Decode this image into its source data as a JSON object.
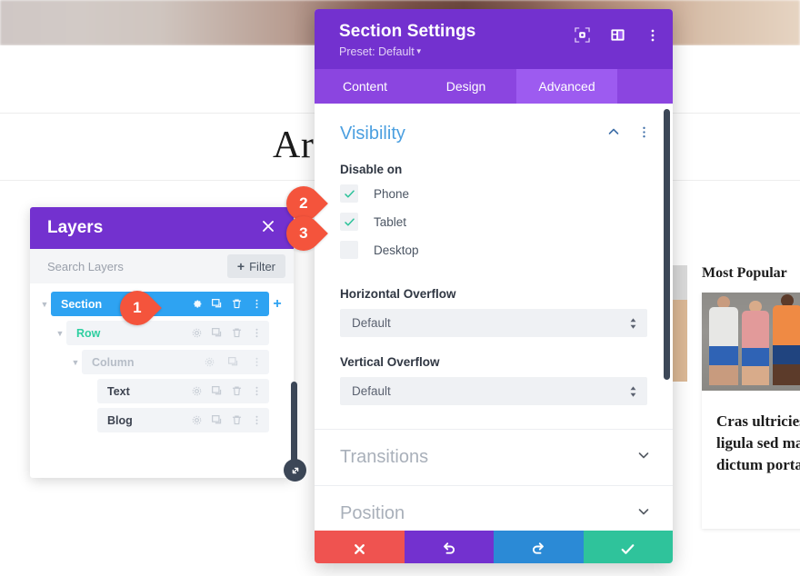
{
  "background": {
    "heading": "Ar",
    "most_popular_label": "Most Popular",
    "card_text": "Cras ultricies ligula sed magna dictum porta"
  },
  "layers_panel": {
    "title": "Layers",
    "close_icon": "close-icon",
    "search_placeholder": "Search Layers",
    "filter_label": "Filter",
    "filter_plus": "+",
    "add_plus": "+",
    "rows": [
      {
        "label": "Section",
        "icons": [
          "gear-icon",
          "duplicate-icon",
          "trash-icon",
          "more-icon"
        ]
      },
      {
        "label": "Row",
        "icons": [
          "gear-icon",
          "duplicate-icon",
          "trash-icon",
          "more-icon"
        ]
      },
      {
        "label": "Column",
        "icons": [
          "gear-icon",
          "duplicate-icon",
          "more-icon"
        ]
      },
      {
        "label": "Text",
        "icons": [
          "gear-icon",
          "duplicate-icon",
          "trash-icon",
          "more-icon"
        ]
      },
      {
        "label": "Blog",
        "icons": [
          "gear-icon",
          "duplicate-icon",
          "trash-icon",
          "more-icon"
        ]
      }
    ]
  },
  "settings_modal": {
    "title": "Section Settings",
    "preset_label": "Preset: Default",
    "header_icons": [
      "focus-icon",
      "layout-icon",
      "more-vertical-icon"
    ],
    "tabs": [
      {
        "label": "Content",
        "active": false
      },
      {
        "label": "Design",
        "active": false
      },
      {
        "label": "Advanced",
        "active": true
      }
    ],
    "visibility": {
      "section_title": "Visibility",
      "collapse_icon": "chevron-up-icon",
      "more_icon": "more-vertical-icon",
      "disable_on_label": "Disable on",
      "options": [
        {
          "label": "Phone",
          "checked": true
        },
        {
          "label": "Tablet",
          "checked": true
        },
        {
          "label": "Desktop",
          "checked": false
        }
      ],
      "horizontal_overflow_label": "Horizontal Overflow",
      "horizontal_overflow_value": "Default",
      "vertical_overflow_label": "Vertical Overflow",
      "vertical_overflow_value": "Default"
    },
    "collapsed_sections": [
      {
        "title": "Transitions",
        "icon": "chevron-down-icon"
      },
      {
        "title": "Position",
        "icon": "chevron-down-icon"
      }
    ],
    "footer_buttons": [
      {
        "name": "cancel-button",
        "icon": "close-icon",
        "color": "#ef5350"
      },
      {
        "name": "undo-button",
        "icon": "undo-icon",
        "color": "#7331cf"
      },
      {
        "name": "redo-button",
        "icon": "redo-icon",
        "color": "#2b8ad6"
      },
      {
        "name": "save-button",
        "icon": "check-icon",
        "color": "#2fc39b"
      }
    ]
  },
  "markers": [
    {
      "number": "1"
    },
    {
      "number": "2"
    },
    {
      "number": "3"
    }
  ],
  "colors": {
    "purple_header": "#7331cf",
    "tab_bar": "#8b45e0",
    "tab_active": "#9d5bf0",
    "section_blue": "#2ea3f2",
    "visibility_blue": "#4b9fe0",
    "check_green": "#2fc39b",
    "marker_red": "#f4543c"
  }
}
